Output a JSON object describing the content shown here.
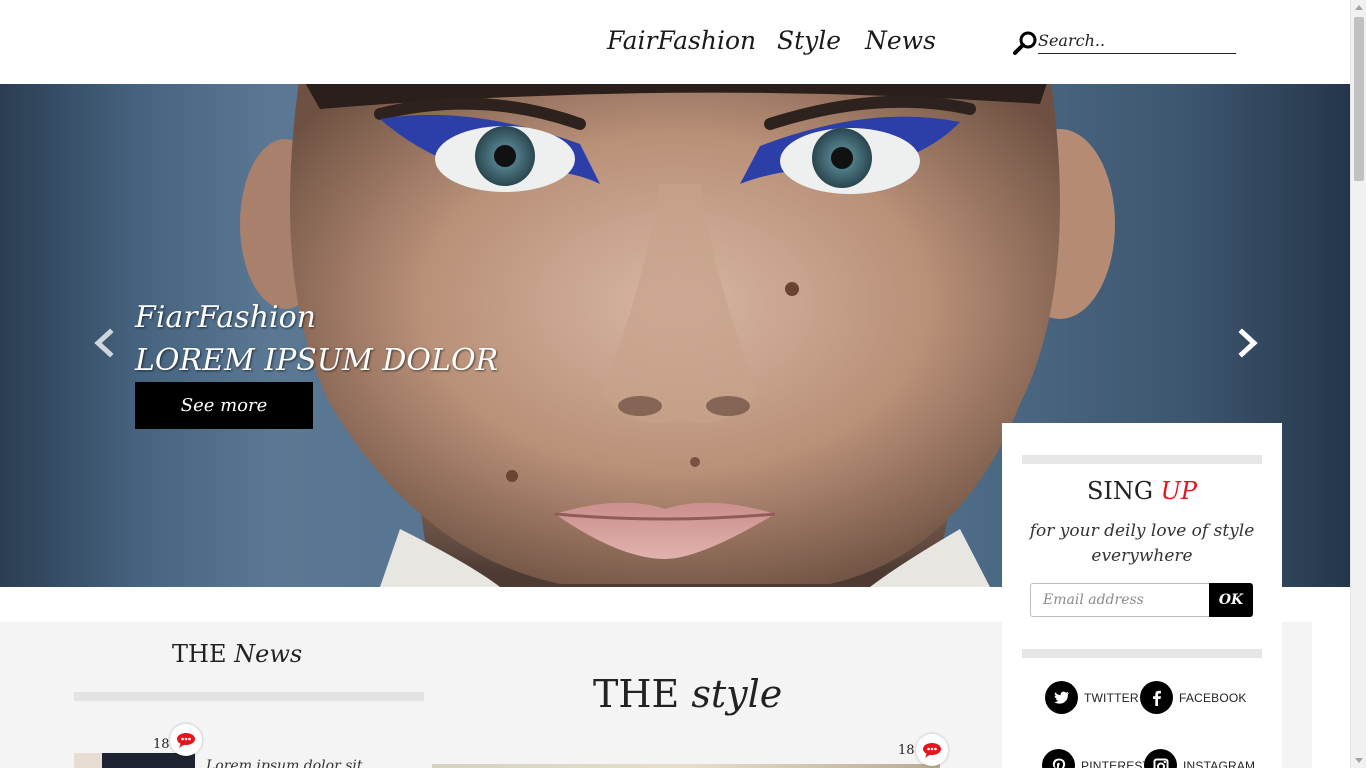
{
  "header": {
    "nav": [
      "FairFashion",
      "Style",
      "News"
    ],
    "search_placeholder": "Search.."
  },
  "hero": {
    "brand": "FiarFashion",
    "headline": "LOREM IPSUM DOLOR",
    "cta_label": "See more"
  },
  "signup": {
    "title_prefix": "SING",
    "title_accent": "UP",
    "subtitle": "for your deily love of style everywhere",
    "email_placeholder": "Email address",
    "submit_label": "OK",
    "accent_color": "#e8131c",
    "social": [
      {
        "icon": "twitter-icon",
        "label": "TWITTER"
      },
      {
        "icon": "facebook-icon",
        "label": "FACEBOOK"
      },
      {
        "icon": "pinterest-icon",
        "label": "PINTEREST"
      },
      {
        "icon": "instagram-icon",
        "label": "INSTAGRAM"
      }
    ]
  },
  "news": {
    "title_prefix": "THE",
    "title_accent": "News",
    "comment_count": "18",
    "snippet": "Lorem ipsum dolor sit"
  },
  "style": {
    "title_prefix": "THE",
    "title_accent": "style",
    "comment_count": "18"
  },
  "colors": {
    "comment_icon": "#e8131c"
  }
}
